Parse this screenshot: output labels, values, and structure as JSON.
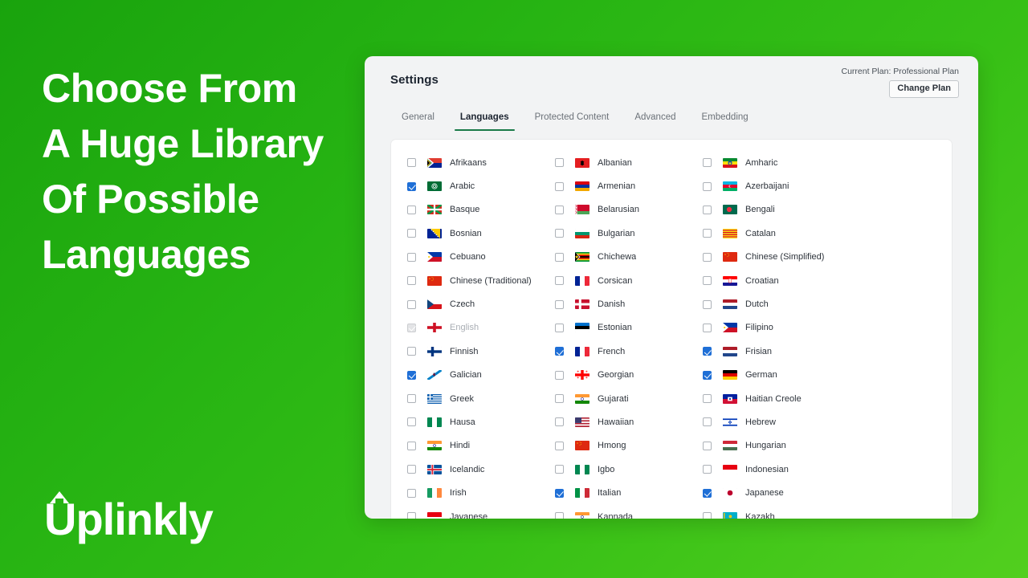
{
  "promo": {
    "lines": [
      "Choose From",
      "A Huge Library",
      "Of Possible",
      "Languages"
    ],
    "brand_name": "Uplinkly",
    "brand_icon": "up-arrow-icon"
  },
  "colors": {
    "background_start": "#19a30d",
    "background_end": "#52cf1f",
    "accent_tab_underline": "#1a7a48",
    "checkbox_checked": "#1f6fd6",
    "card_background": "#f2f3f4",
    "panel_background": "#ffffff"
  },
  "card": {
    "title": "Settings",
    "plan_text": "Current Plan: Professional Plan",
    "change_plan_label": "Change Plan"
  },
  "tabs": [
    {
      "label": "General",
      "active": false
    },
    {
      "label": "Languages",
      "active": true
    },
    {
      "label": "Protected Content",
      "active": false
    },
    {
      "label": "Advanced",
      "active": false
    },
    {
      "label": "Embedding",
      "active": false
    }
  ],
  "languages": {
    "column1": [
      {
        "label": "Afrikaans",
        "checked": false,
        "disabled": false,
        "flag": "za"
      },
      {
        "label": "Arabic",
        "checked": true,
        "disabled": false,
        "flag": "sa"
      },
      {
        "label": "Basque",
        "checked": false,
        "disabled": false,
        "flag": "eus"
      },
      {
        "label": "Bosnian",
        "checked": false,
        "disabled": false,
        "flag": "ba"
      },
      {
        "label": "Cebuano",
        "checked": false,
        "disabled": false,
        "flag": "ph"
      },
      {
        "label": "Chinese (Traditional)",
        "checked": false,
        "disabled": false,
        "flag": "cn"
      },
      {
        "label": "Czech",
        "checked": false,
        "disabled": false,
        "flag": "cz"
      },
      {
        "label": "English",
        "checked": true,
        "disabled": true,
        "flag": "eng"
      },
      {
        "label": "Finnish",
        "checked": false,
        "disabled": false,
        "flag": "fi"
      },
      {
        "label": "Galician",
        "checked": true,
        "disabled": false,
        "flag": "gal"
      },
      {
        "label": "Greek",
        "checked": false,
        "disabled": false,
        "flag": "gr"
      },
      {
        "label": "Hausa",
        "checked": false,
        "disabled": false,
        "flag": "ng"
      },
      {
        "label": "Hindi",
        "checked": false,
        "disabled": false,
        "flag": "in"
      },
      {
        "label": "Icelandic",
        "checked": false,
        "disabled": false,
        "flag": "is"
      },
      {
        "label": "Irish",
        "checked": false,
        "disabled": false,
        "flag": "ie"
      },
      {
        "label": "Javanese",
        "checked": false,
        "disabled": false,
        "flag": "id"
      }
    ],
    "column2": [
      {
        "label": "Albanian",
        "checked": false,
        "disabled": false,
        "flag": "al"
      },
      {
        "label": "Armenian",
        "checked": false,
        "disabled": false,
        "flag": "am"
      },
      {
        "label": "Belarusian",
        "checked": false,
        "disabled": false,
        "flag": "by"
      },
      {
        "label": "Bulgarian",
        "checked": false,
        "disabled": false,
        "flag": "bg"
      },
      {
        "label": "Chichewa",
        "checked": false,
        "disabled": false,
        "flag": "zw"
      },
      {
        "label": "Corsican",
        "checked": false,
        "disabled": false,
        "flag": "fr"
      },
      {
        "label": "Danish",
        "checked": false,
        "disabled": false,
        "flag": "dk"
      },
      {
        "label": "Estonian",
        "checked": false,
        "disabled": false,
        "flag": "ee"
      },
      {
        "label": "French",
        "checked": true,
        "disabled": false,
        "flag": "fr"
      },
      {
        "label": "Georgian",
        "checked": false,
        "disabled": false,
        "flag": "ge"
      },
      {
        "label": "Gujarati",
        "checked": false,
        "disabled": false,
        "flag": "in"
      },
      {
        "label": "Hawaiian",
        "checked": false,
        "disabled": false,
        "flag": "us"
      },
      {
        "label": "Hmong",
        "checked": false,
        "disabled": false,
        "flag": "cn"
      },
      {
        "label": "Igbo",
        "checked": false,
        "disabled": false,
        "flag": "ng"
      },
      {
        "label": "Italian",
        "checked": true,
        "disabled": false,
        "flag": "it"
      },
      {
        "label": "Kannada",
        "checked": false,
        "disabled": false,
        "flag": "in"
      }
    ],
    "column3": [
      {
        "label": "Amharic",
        "checked": false,
        "disabled": false,
        "flag": "et"
      },
      {
        "label": "Azerbaijani",
        "checked": false,
        "disabled": false,
        "flag": "az"
      },
      {
        "label": "Bengali",
        "checked": false,
        "disabled": false,
        "flag": "bd"
      },
      {
        "label": "Catalan",
        "checked": false,
        "disabled": false,
        "flag": "cat"
      },
      {
        "label": "Chinese (Simplified)",
        "checked": false,
        "disabled": false,
        "flag": "cn"
      },
      {
        "label": "Croatian",
        "checked": false,
        "disabled": false,
        "flag": "hr"
      },
      {
        "label": "Dutch",
        "checked": false,
        "disabled": false,
        "flag": "nl"
      },
      {
        "label": "Filipino",
        "checked": false,
        "disabled": false,
        "flag": "ph"
      },
      {
        "label": "Frisian",
        "checked": true,
        "disabled": false,
        "flag": "nl"
      },
      {
        "label": "German",
        "checked": true,
        "disabled": false,
        "flag": "de"
      },
      {
        "label": "Haitian Creole",
        "checked": false,
        "disabled": false,
        "flag": "ht"
      },
      {
        "label": "Hebrew",
        "checked": false,
        "disabled": false,
        "flag": "il"
      },
      {
        "label": "Hungarian",
        "checked": false,
        "disabled": false,
        "flag": "hu"
      },
      {
        "label": "Indonesian",
        "checked": false,
        "disabled": false,
        "flag": "id"
      },
      {
        "label": "Japanese",
        "checked": true,
        "disabled": false,
        "flag": "jp"
      },
      {
        "label": "Kazakh",
        "checked": false,
        "disabled": false,
        "flag": "kz"
      }
    ]
  }
}
